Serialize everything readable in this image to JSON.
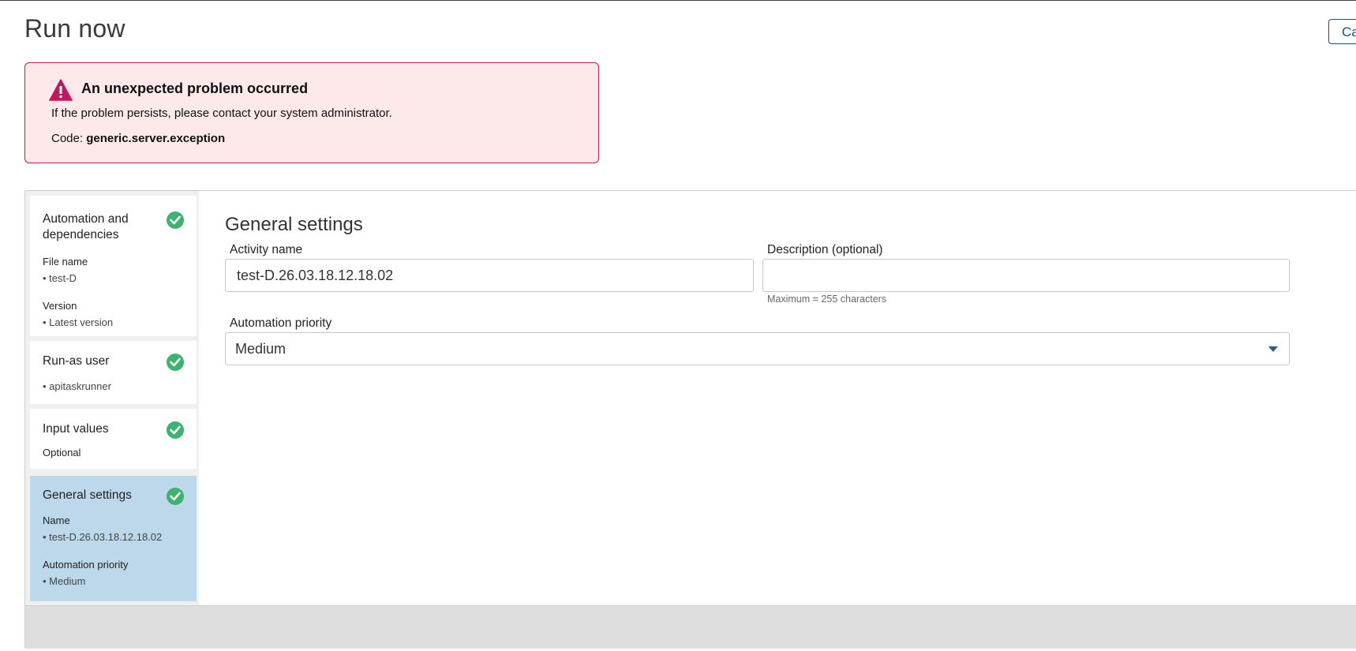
{
  "page": {
    "title": "Run now"
  },
  "header": {
    "cancel_label": "Ca"
  },
  "error": {
    "title": "An unexpected problem occurred",
    "message": "If the problem persists, please contact your system administrator.",
    "code_label": "Code:",
    "code_value": "generic.server.exception",
    "icon": "warning-triangle-icon",
    "color": "#c2185b"
  },
  "steps": [
    {
      "title": "Automation and dependencies",
      "status": "complete",
      "details": [
        {
          "label": "File name",
          "value": "• test-D"
        },
        {
          "label": "Version",
          "value": "• Latest version"
        }
      ]
    },
    {
      "title": "Run-as user",
      "status": "complete",
      "details": [
        {
          "label": "",
          "value": "• apitaskrunner"
        }
      ]
    },
    {
      "title": "Input values",
      "status": "complete",
      "details": [
        {
          "label": "Optional",
          "value": ""
        }
      ]
    },
    {
      "title": "General settings",
      "status": "complete",
      "active": true,
      "details": [
        {
          "label": "Name",
          "value": "• test-D.26.03.18.12.18.02"
        },
        {
          "label": "Automation priority",
          "value": "• Medium"
        }
      ]
    }
  ],
  "general_settings": {
    "title": "General settings",
    "activity_name": {
      "label": "Activity name",
      "value": "test-D.26.03.18.12.18.02"
    },
    "description": {
      "label": "Description (optional)",
      "value": "",
      "hint": "Maximum = 255 characters"
    },
    "priority": {
      "label": "Automation priority",
      "selected": "Medium"
    }
  },
  "colors": {
    "check": "#3cb371",
    "active_step": "#bcd8ea",
    "error_bg": "#fde8ea",
    "accent": "#1f4e79"
  }
}
